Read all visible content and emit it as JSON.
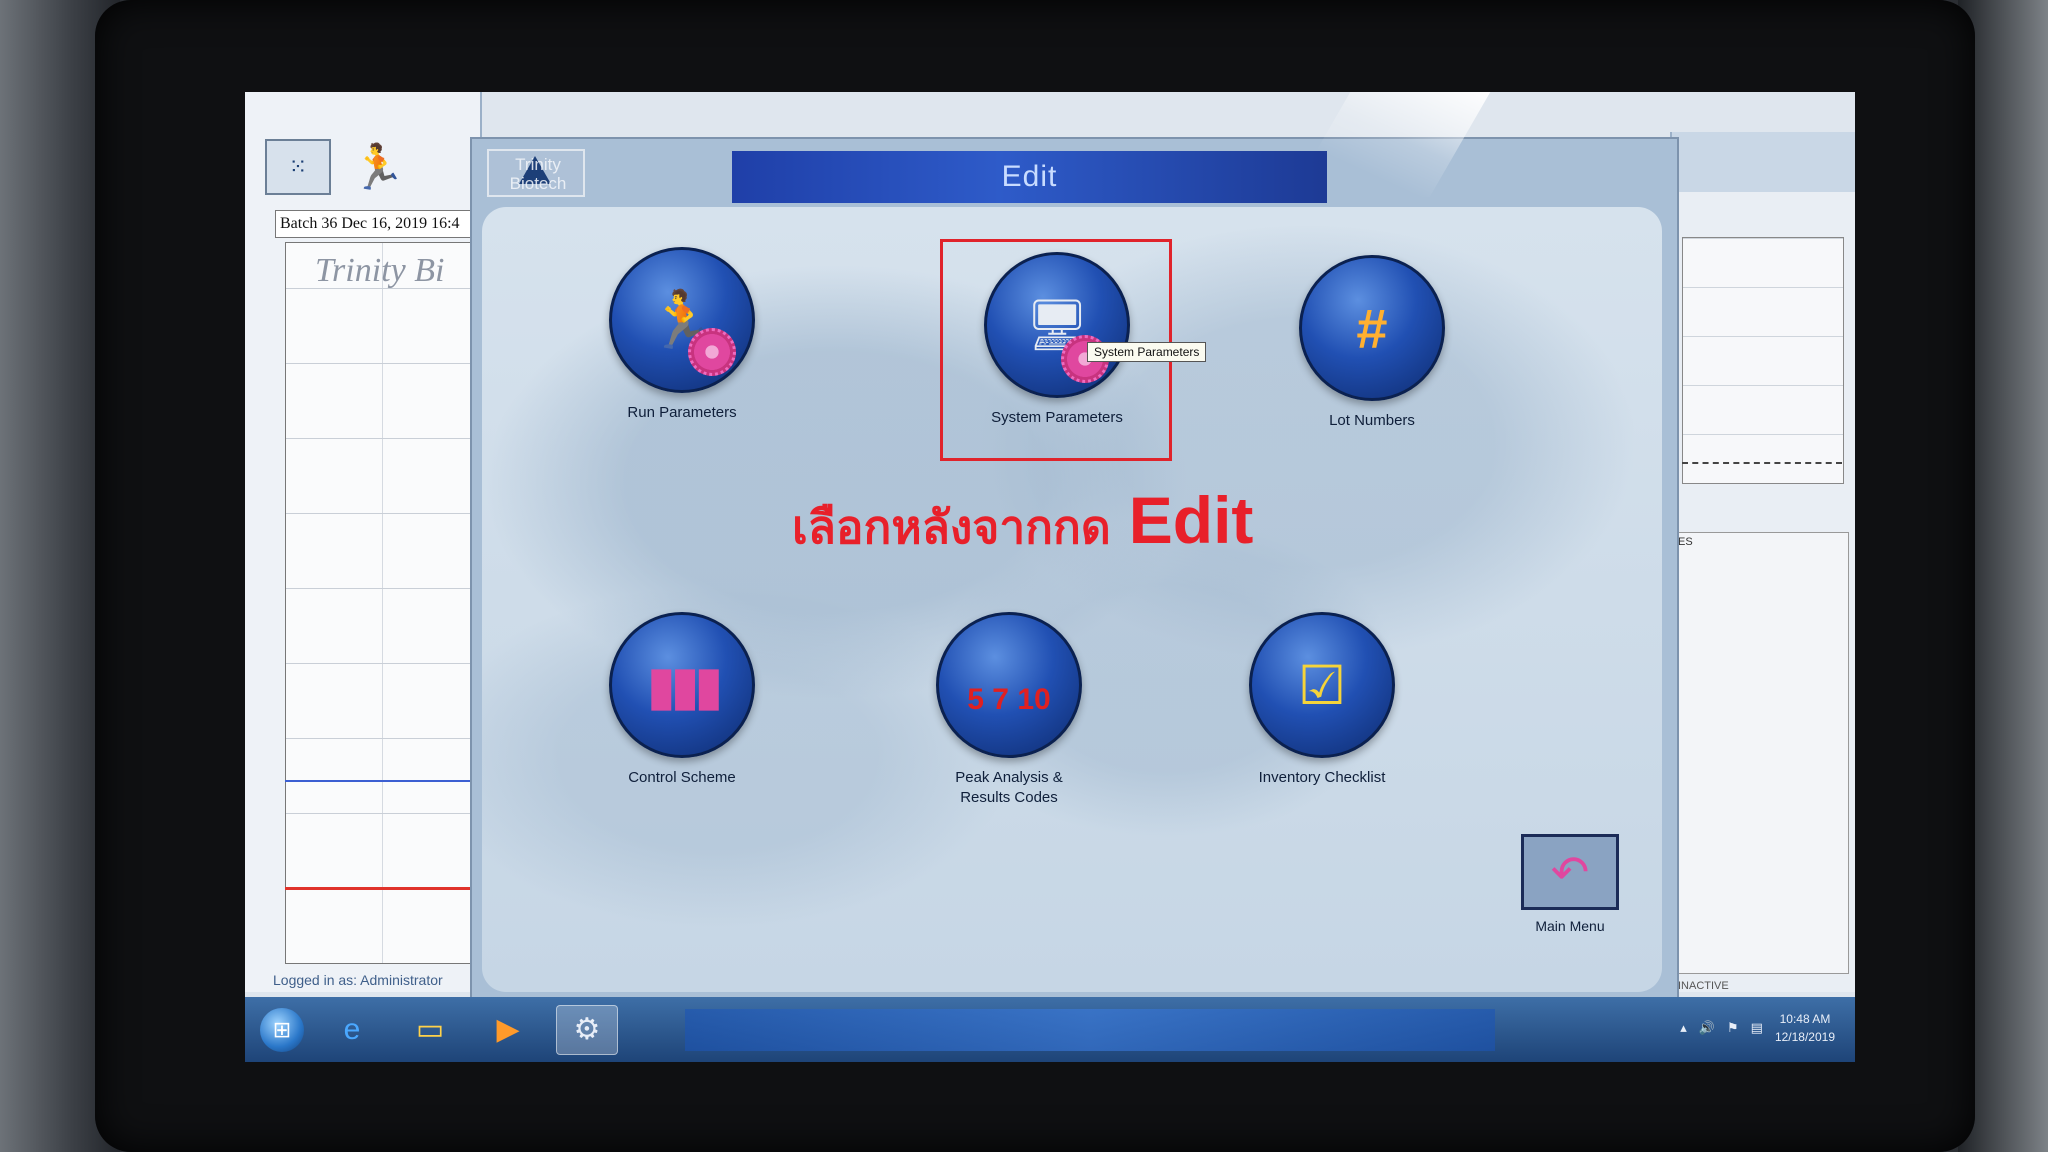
{
  "background_app": {
    "batch_text": "Batch 36 Dec 16, 2019 16:4",
    "brand_text": "Trinity Bi",
    "logged_in": "Logged in as: Administrator",
    "right_box_label": "ES",
    "right_status": "INACTIVE"
  },
  "dialog": {
    "logo_text": "Trinity\nBiotech",
    "title": "Edit",
    "tiles": [
      {
        "label": "Run Parameters",
        "icon": "run-parameters-icon"
      },
      {
        "label": "System Parameters",
        "icon": "system-parameters-icon"
      },
      {
        "label": "Lot Numbers",
        "icon": "lot-numbers-icon",
        "glyph": "#"
      },
      {
        "label": "Control Scheme",
        "icon": "control-scheme-icon"
      },
      {
        "label": "Peak Analysis &\nResults Codes",
        "icon": "peak-analysis-icon",
        "glyph": "5 7 10"
      },
      {
        "label": "Inventory Checklist",
        "icon": "inventory-checklist-icon"
      }
    ],
    "tooltip": "System Parameters",
    "main_menu_label": "Main Menu"
  },
  "annotation": {
    "thai": "เลือกหลังจากกด",
    "english": "Edit",
    "color": "#e8202a"
  },
  "taskbar": {
    "time": "10:48 AM",
    "date": "12/18/2019"
  },
  "colors": {
    "title_bar": "#2e5bc9",
    "highlight": "#e0232b",
    "orb": "#2150b3",
    "gear": "#e0479f"
  }
}
